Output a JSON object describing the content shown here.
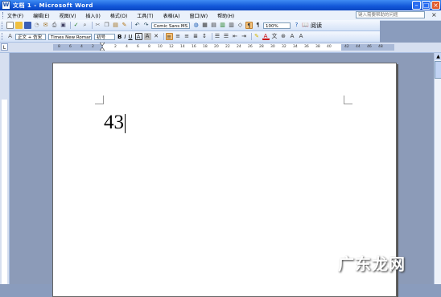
{
  "titlebar": {
    "title": "文档 1 - Microsoft Word"
  },
  "menubar": {
    "items": [
      "文件(F)",
      "编辑(E)",
      "视图(V)",
      "插入(I)",
      "格式(O)",
      "工具(T)",
      "表格(A)",
      "窗口(W)",
      "帮助(H)"
    ],
    "help_placeholder": "键入需要帮助的问题"
  },
  "toolbar_std": {
    "font_name": "Comic Sans MS",
    "zoom": "100%",
    "read_label": "阅读"
  },
  "toolbar_fmt": {
    "style": "正文 + 仿宋",
    "font": "Times New Roman",
    "size": "初号",
    "bold": "B",
    "italic": "I",
    "underline": "U"
  },
  "ruler": {
    "ticks": [
      "8",
      "6",
      "4",
      "2",
      "",
      "2",
      "4",
      "6",
      "8",
      "10",
      "12",
      "14",
      "16",
      "18",
      "20",
      "22",
      "24",
      "26",
      "28",
      "30",
      "32",
      "34",
      "36",
      "38",
      "40",
      "42",
      "44",
      "46",
      "48"
    ]
  },
  "document": {
    "text": "43"
  },
  "watermark": "广东龙网",
  "colors": {
    "titlebar": "#1257d8",
    "menubar": "#eaf1fb",
    "workspace": "#8c9bb8"
  }
}
